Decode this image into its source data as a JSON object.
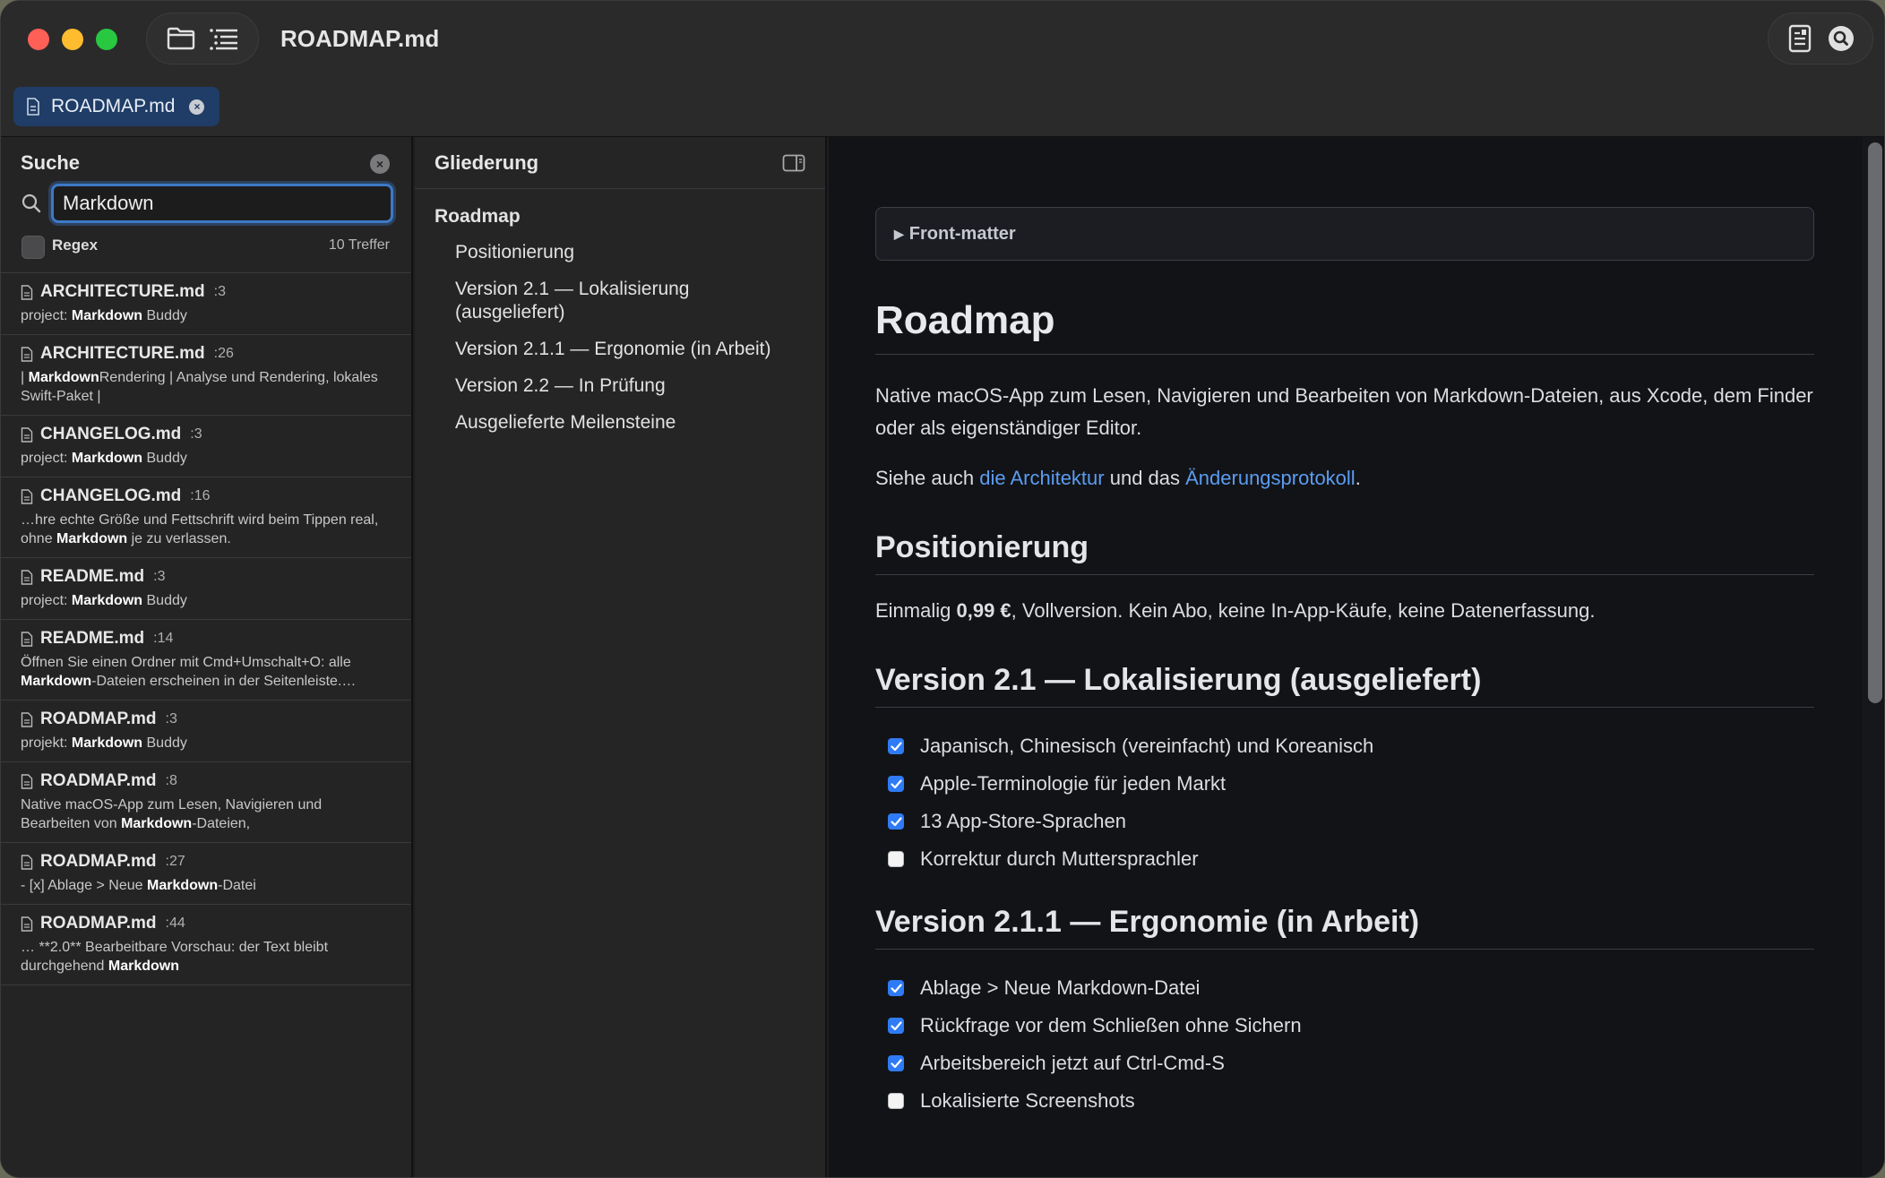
{
  "window": {
    "title": "ROADMAP.md"
  },
  "toolbar": {
    "folder_icon": "folder-icon",
    "outline_icon": "list-icon",
    "right_icons": [
      "document-info-icon",
      "search-icon"
    ]
  },
  "tab": {
    "label": "ROADMAP.md",
    "close": "×"
  },
  "search": {
    "title": "Suche",
    "close": "×",
    "query": "Markdown",
    "regex_label": "Regex",
    "hit_count": "10 Treffer",
    "results": [
      {
        "file": "ARCHITECTURE.md",
        "line": ":3",
        "snippet": "project: <b>Markdown</b> Buddy"
      },
      {
        "file": "ARCHITECTURE.md",
        "line": ":26",
        "snippet": "| <b>Markdown</b>Rendering | Analyse und Rendering, lokales Swift-Paket |"
      },
      {
        "file": "CHANGELOG.md",
        "line": ":3",
        "snippet": "project: <b>Markdown</b> Buddy"
      },
      {
        "file": "CHANGELOG.md",
        "line": ":16",
        "snippet": "…hre echte Größe und Fettschrift wird beim Tippen real, ohne <b>Markdown</b> je zu verlassen."
      },
      {
        "file": "README.md",
        "line": ":3",
        "snippet": "project: <b>Markdown</b> Buddy"
      },
      {
        "file": "README.md",
        "line": ":14",
        "snippet": "Öffnen Sie einen Ordner mit Cmd+Umschalt+O: alle <b>Markdown</b>-Dateien erscheinen in der Seitenleiste.…"
      },
      {
        "file": "ROADMAP.md",
        "line": ":3",
        "snippet": "projekt: <b>Markdown</b> Buddy"
      },
      {
        "file": "ROADMAP.md",
        "line": ":8",
        "snippet": "Native macOS-App zum Lesen, Navigieren und Bearbeiten von <b>Markdown</b>-Dateien,"
      },
      {
        "file": "ROADMAP.md",
        "line": ":27",
        "snippet": "- [x] Ablage > Neue <b>Markdown</b>-Datei"
      },
      {
        "file": "ROADMAP.md",
        "line": ":44",
        "snippet": "… **2.0** Bearbeitbare Vorschau: der Text bleibt durchgehend <b>Markdown</b>"
      }
    ]
  },
  "outline": {
    "title": "Gliederung",
    "items": [
      {
        "label": "Roadmap",
        "level": 1
      },
      {
        "label": "Positionierung",
        "level": 2
      },
      {
        "label": "Version 2.1 — Lokalisierung (ausgeliefert)",
        "level": 2
      },
      {
        "label": "Version 2.1.1 — Ergonomie (in Arbeit)",
        "level": 2
      },
      {
        "label": "Version 2.2 — In Prüfung",
        "level": 2
      },
      {
        "label": "Ausgelieferte Meilensteine",
        "level": 2
      }
    ]
  },
  "document": {
    "frontmatter_label": "Front-matter",
    "h1": "Roadmap",
    "intro": "Native macOS-App zum Lesen, Navigieren und Bearbeiten von Markdown-Dateien, aus Xcode, dem Finder oder als eigenständiger Editor.",
    "see_also": {
      "prefix": "Siehe auch ",
      "link1": "die Architektur",
      "middle": " und das ",
      "link2": "Änderungsprotokoll",
      "suffix": "."
    },
    "positioning": {
      "heading": "Positionierung",
      "prefix": "Einmalig ",
      "price": "0,99 €",
      "suffix": ", Vollversion. Kein Abo, keine In-App-Käufe, keine Datenerfassung."
    },
    "v21": {
      "heading": "Version 2.1 — Lokalisierung (ausgeliefert)",
      "tasks": [
        {
          "label": "Japanisch, Chinesisch (vereinfacht) und Koreanisch",
          "done": true
        },
        {
          "label": "Apple-Terminologie für jeden Markt",
          "done": true
        },
        {
          "label": "13 App-Store-Sprachen",
          "done": true
        },
        {
          "label": "Korrektur durch Muttersprachler",
          "done": false
        }
      ]
    },
    "v211": {
      "heading": "Version 2.1.1 — Ergonomie (in Arbeit)",
      "tasks": [
        {
          "label": "Ablage > Neue Markdown-Datei",
          "done": true
        },
        {
          "label": "Rückfrage vor dem Schließen ohne Sichern",
          "done": true
        },
        {
          "label": "Arbeitsbereich jetzt auf Ctrl-Cmd-S",
          "done": true
        },
        {
          "label": "Lokalisierte Screenshots",
          "done": false
        }
      ]
    }
  },
  "colors": {
    "accent": "#2f7bf5",
    "link": "#5b9cf2",
    "tab": "#1f3d66"
  }
}
